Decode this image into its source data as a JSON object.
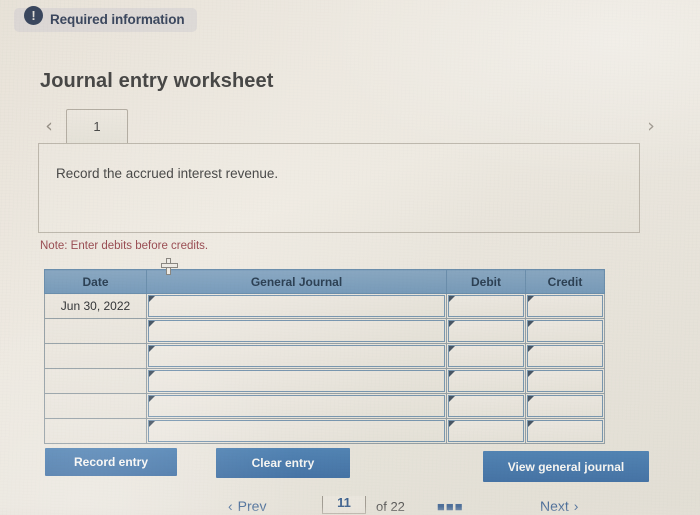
{
  "alert": {
    "icon": "exclamation-icon",
    "label": "Required information"
  },
  "worksheet": {
    "title": "Journal entry worksheet",
    "prev_icon": "chevron-left-icon",
    "next_icon": "chevron-right-icon",
    "tabs": [
      {
        "label": "1",
        "active": true
      }
    ],
    "instruction": "Record the accrued interest revenue.",
    "note": "Note: Enter debits before credits."
  },
  "journal_table": {
    "columns": [
      "Date",
      "General Journal",
      "Debit",
      "Credit"
    ],
    "rows": [
      {
        "date": "Jun 30, 2022",
        "general_journal": "",
        "debit": "",
        "credit": ""
      },
      {
        "date": "",
        "general_journal": "",
        "debit": "",
        "credit": ""
      },
      {
        "date": "",
        "general_journal": "",
        "debit": "",
        "credit": ""
      },
      {
        "date": "",
        "general_journal": "",
        "debit": "",
        "credit": ""
      },
      {
        "date": "",
        "general_journal": "",
        "debit": "",
        "credit": ""
      },
      {
        "date": "",
        "general_journal": "",
        "debit": "",
        "credit": ""
      }
    ]
  },
  "actions": {
    "record_entry": "Record entry",
    "clear_entry": "Clear entry",
    "view_general_journal": "View general journal"
  },
  "bottom_nav": {
    "prev_label": "Prev",
    "prev_icon": "chevron-left-icon",
    "page_value": "11",
    "of_label": "of 22",
    "grid_icon": "grid-icon",
    "next_label": "Next",
    "next_icon": "chevron-right-icon"
  },
  "colors": {
    "header_blue": "#7ba0c2",
    "button_blue": "#4878ae",
    "note_red": "#9e5057",
    "badge_navy": "#3d4a63",
    "page_bg": "#f0ece6"
  }
}
